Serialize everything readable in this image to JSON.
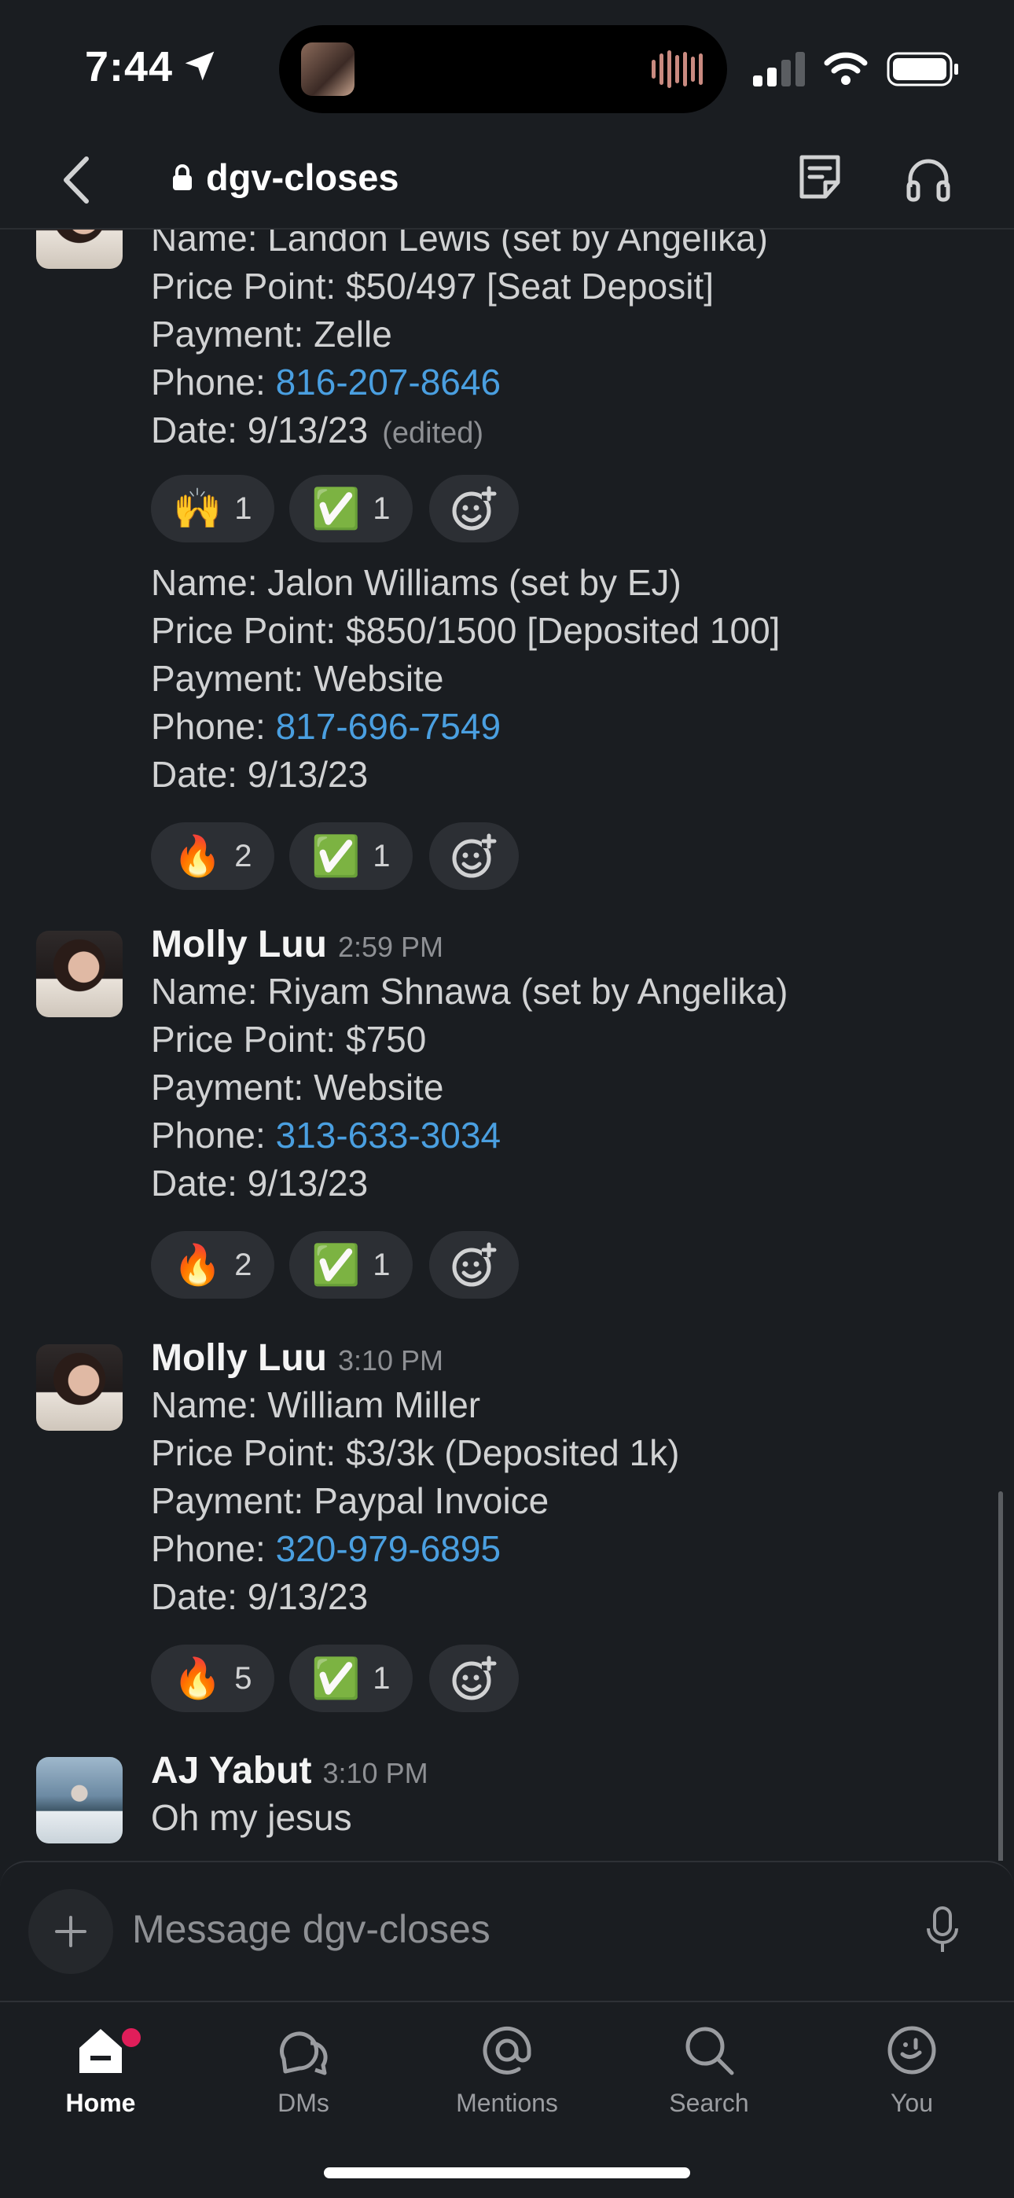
{
  "status": {
    "time": "7:44"
  },
  "header": {
    "channel": "dgv-closes"
  },
  "messages": [
    {
      "continued": true,
      "lines": {
        "name": "Name: Landon Lewis (set by Angelika)",
        "price": "Price Point: $50/497 [Seat Deposit]",
        "payment": "Payment: Zelle",
        "phone_label": "Phone: ",
        "phone": "816-207-8646",
        "date": "Date: 9/13/23",
        "edited": "(edited)"
      },
      "reactions": [
        {
          "emoji": "🙌",
          "count": "1"
        },
        {
          "emoji": "✅",
          "count": "1"
        }
      ]
    },
    {
      "continued": true,
      "lines": {
        "name": "Name: Jalon Williams (set by EJ)",
        "price": "Price Point: $850/1500 [Deposited 100]",
        "payment": "Payment: Website",
        "phone_label": "Phone: ",
        "phone": "817-696-7549",
        "date": "Date: 9/13/23"
      },
      "reactions": [
        {
          "emoji": "🔥",
          "count": "2"
        },
        {
          "emoji": "✅",
          "count": "1"
        }
      ]
    },
    {
      "author": "Molly Luu",
      "time": "2:59 PM",
      "lines": {
        "name": "Name: Riyam Shnawa (set by Angelika)",
        "price": "Price Point: $750",
        "payment": "Payment: Website",
        "phone_label": "Phone: ",
        "phone": "313-633-3034",
        "date": "Date: 9/13/23"
      },
      "reactions": [
        {
          "emoji": "🔥",
          "count": "2"
        },
        {
          "emoji": "✅",
          "count": "1"
        }
      ]
    },
    {
      "author": "Molly Luu",
      "time": "3:10 PM",
      "lines": {
        "name": "Name: William Miller",
        "price": "Price Point: $3/3k (Deposited 1k)",
        "payment": "Payment: Paypal Invoice",
        "phone_label": "Phone: ",
        "phone": "320-979-6895",
        "date": "Date: 9/13/23"
      },
      "reactions": [
        {
          "emoji": "🔥",
          "count": "5"
        },
        {
          "emoji": "✅",
          "count": "1"
        }
      ]
    },
    {
      "author": "AJ Yabut",
      "time": "3:10 PM",
      "text": "Oh my jesus"
    }
  ],
  "composer": {
    "placeholder": "Message dgv-closes"
  },
  "tabs": [
    {
      "label": "Home",
      "icon": "home-icon",
      "active": true
    },
    {
      "label": "DMs",
      "icon": "dms-icon"
    },
    {
      "label": "Mentions",
      "icon": "mentions-icon"
    },
    {
      "label": "Search",
      "icon": "search-icon"
    },
    {
      "label": "You",
      "icon": "you-icon"
    }
  ],
  "colors": {
    "background": "#1a1d21",
    "link": "#4a9fe0",
    "badge": "#e01e5a",
    "reaction_bg": "#2c2f34"
  }
}
